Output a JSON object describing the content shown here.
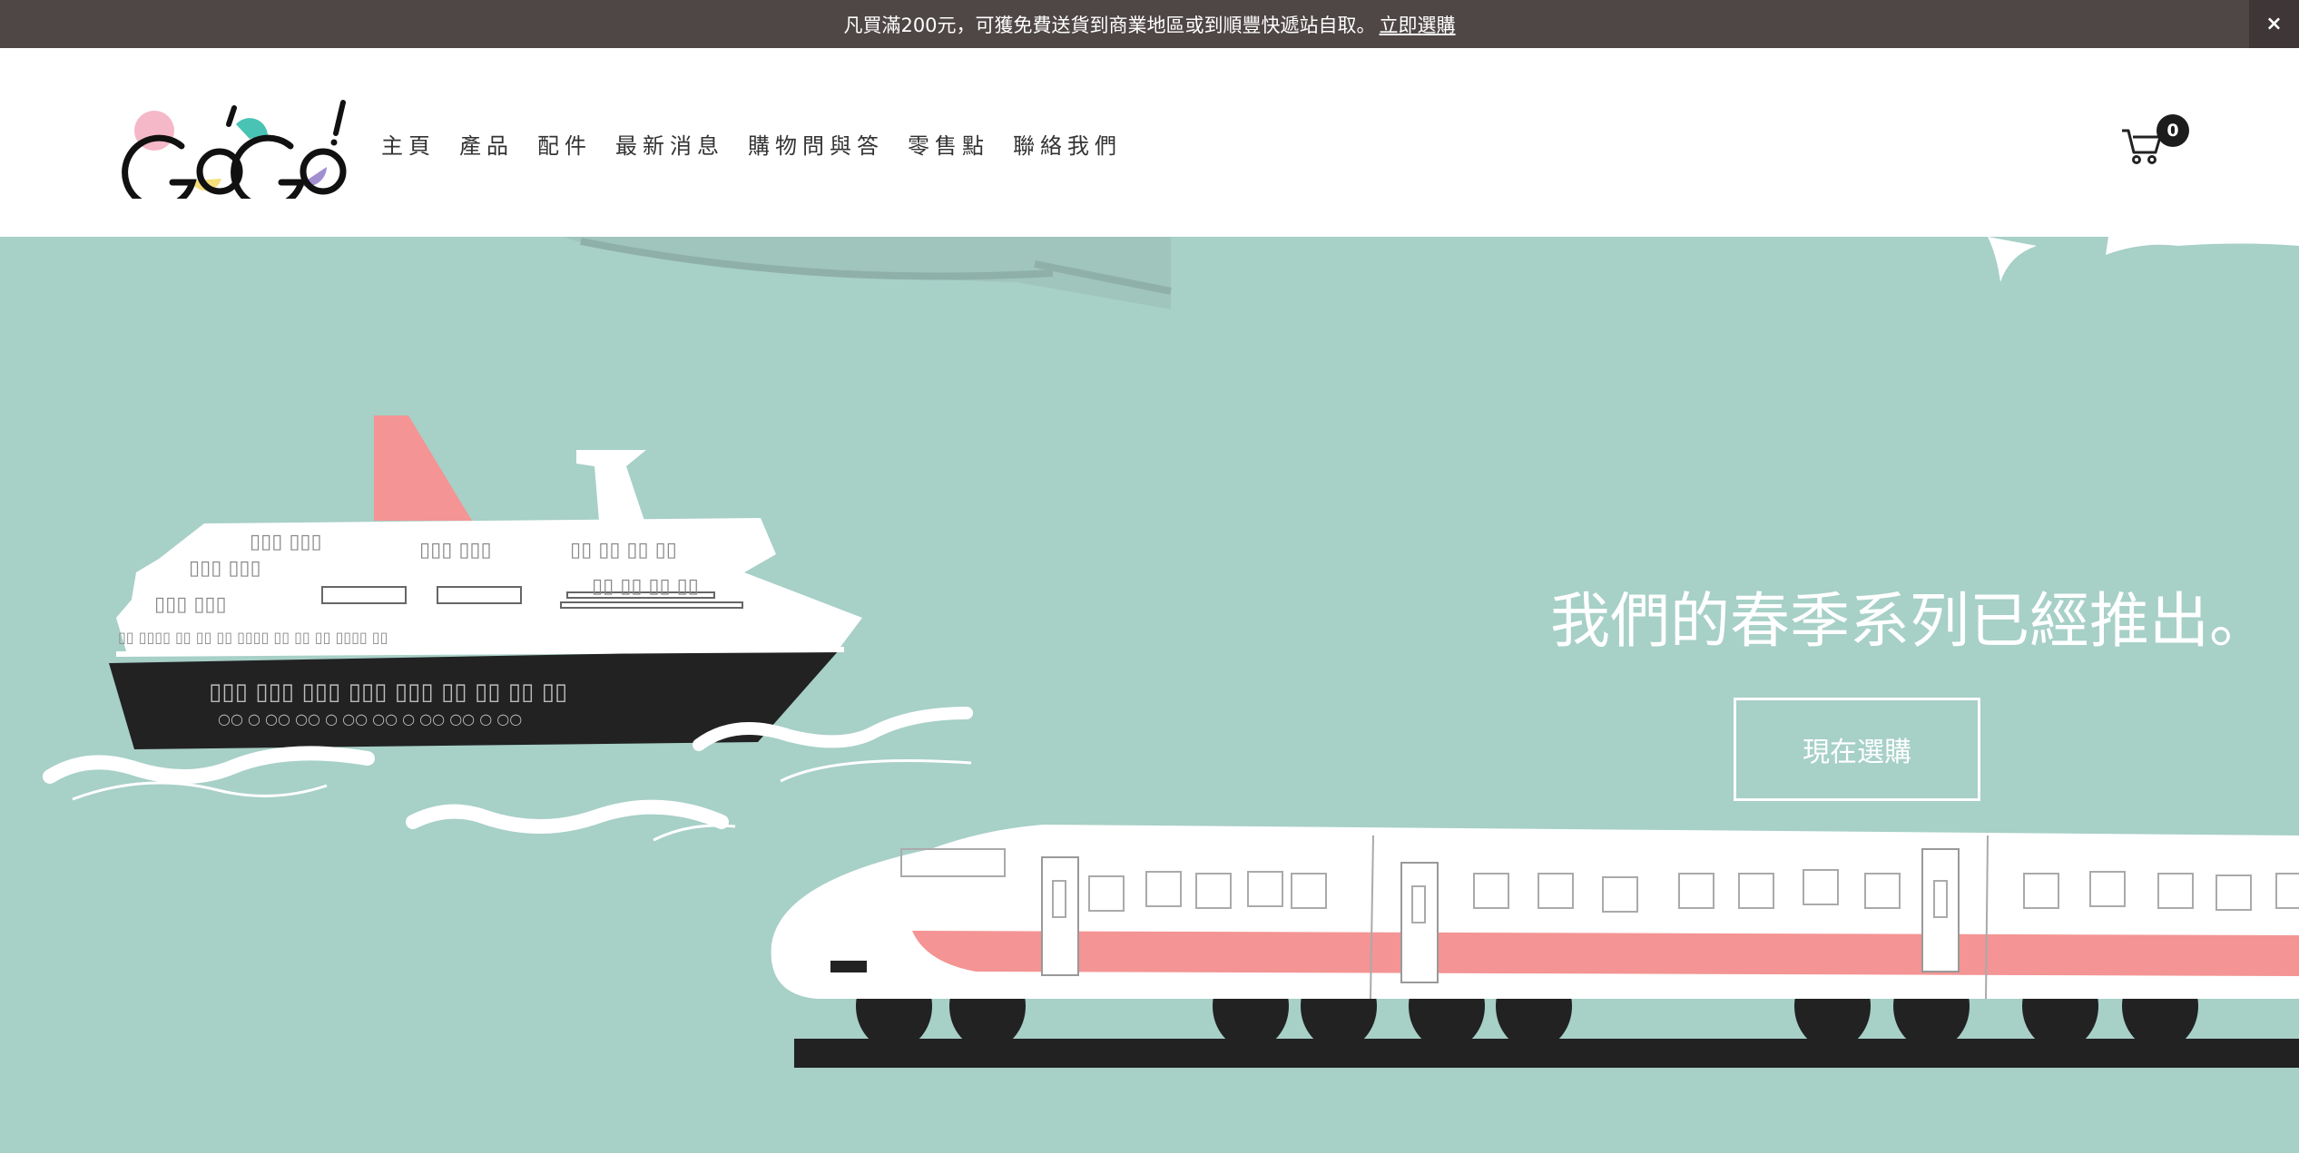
{
  "announcement": {
    "text": "凡買滿200元，可獲免費送貨到商業地區或到順豐快遞站自取。",
    "link_label": "立即選購",
    "close_label": "×"
  },
  "header": {
    "logo_text": "GoGo!",
    "nav": [
      {
        "label": "主頁"
      },
      {
        "label": "產品"
      },
      {
        "label": "配件"
      },
      {
        "label": "最新消息"
      },
      {
        "label": "購物問與答"
      },
      {
        "label": "零售點"
      },
      {
        "label": "聯絡我們"
      }
    ],
    "cart_icon": "shopping-cart-icon",
    "cart_count": "0"
  },
  "hero": {
    "title": "我們的春季系列已經推出。",
    "cta_label": "現在選購",
    "colors": {
      "background": "#a7d0c7",
      "accent": "#f49494",
      "hull": "#222222",
      "white": "#ffffff"
    }
  }
}
